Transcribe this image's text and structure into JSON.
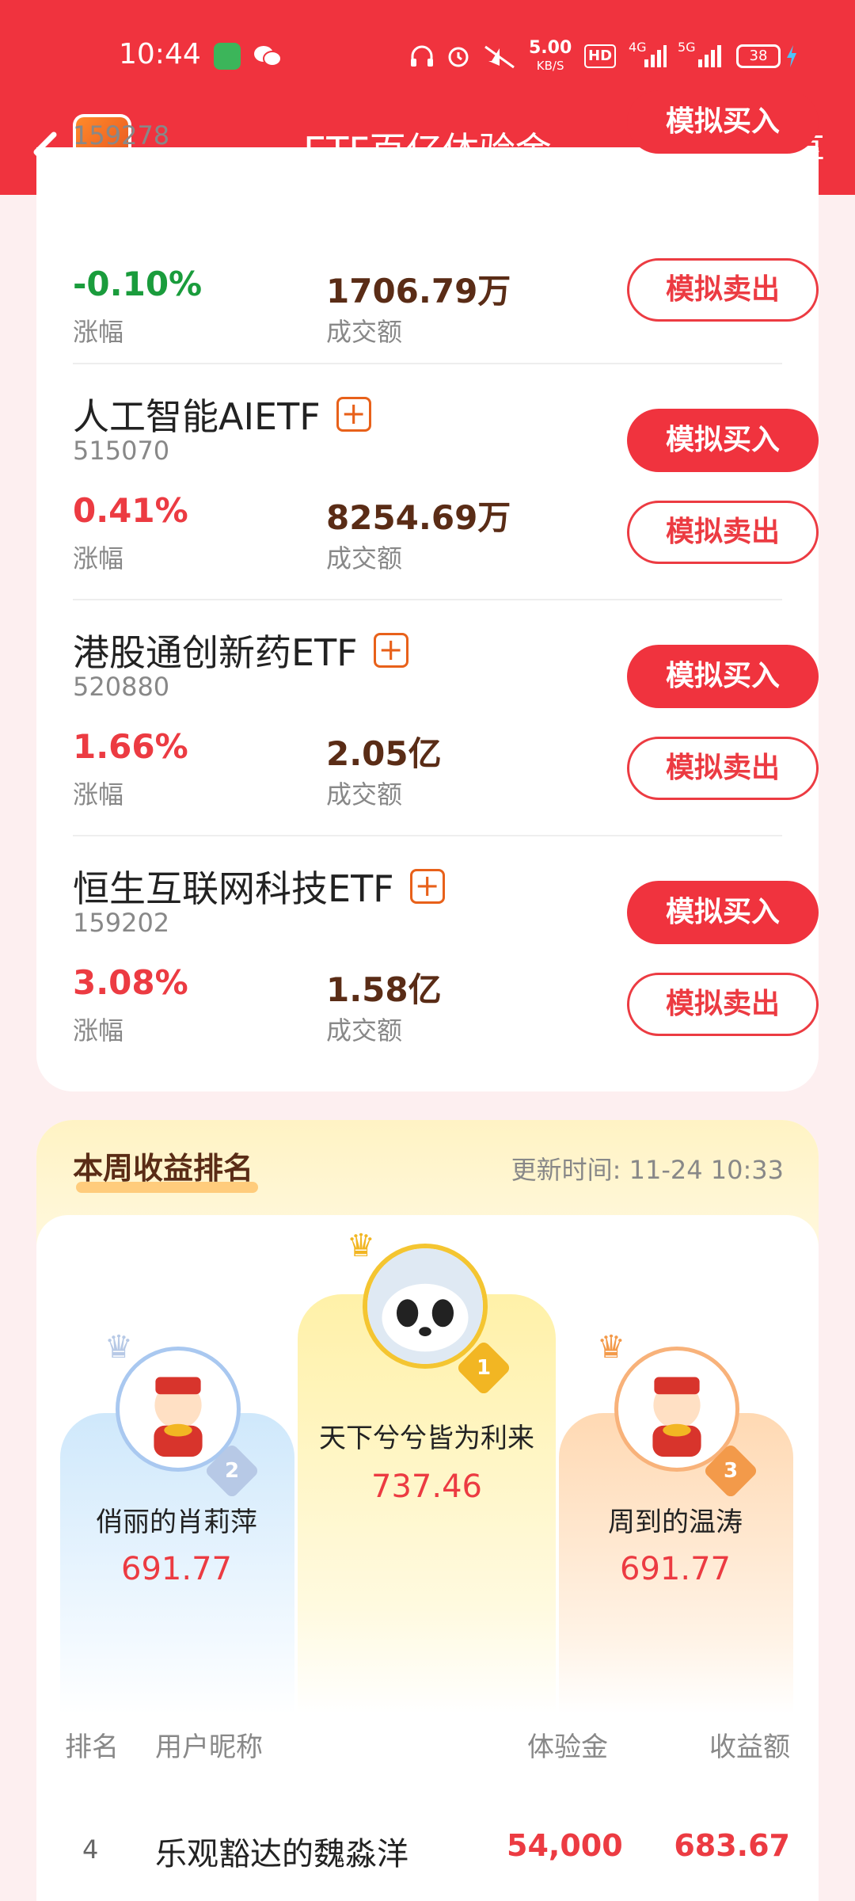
{
  "status_bar": {
    "time": "10:44",
    "speed_value": "5.00",
    "speed_unit": "KB/S",
    "hd": "HD",
    "network_1": "4G",
    "network_2": "5G",
    "battery": "38"
  },
  "header": {
    "title": "ETF百亿体验金",
    "share_label": "分享"
  },
  "etf_list": {
    "buy_label": "模拟买入",
    "sell_label": "模拟卖出",
    "pct_label": "涨幅",
    "vol_label": "成交额",
    "items": [
      {
        "code": "159278",
        "change": "-0.10%",
        "volume": "1706.79万"
      },
      {
        "name": "人工智能AIETF",
        "code": "515070",
        "change": "0.41%",
        "volume": "8254.69万"
      },
      {
        "name": "港股通创新药ETF",
        "code": "520880",
        "change": "1.66%",
        "volume": "2.05亿"
      },
      {
        "name": "恒生互联网科技ETF",
        "code": "159202",
        "change": "3.08%",
        "volume": "1.58亿"
      }
    ]
  },
  "ranking": {
    "title": "本周收益排名",
    "update_time": "更新时间: 11-24 10:33",
    "podium": [
      {
        "rank": "1",
        "name": "天下兮兮皆为利来",
        "value": "737.46"
      },
      {
        "rank": "2",
        "name": "俏丽的肖莉萍",
        "value": "691.77"
      },
      {
        "rank": "3",
        "name": "周到的温涛",
        "value": "691.77"
      }
    ],
    "columns": {
      "rank": "排名",
      "nickname": "用户昵称",
      "amount": "体验金",
      "profit": "收益额"
    },
    "rows": [
      {
        "rank": "4",
        "name": "乐观豁达的魏淼洋",
        "amount": "54,000",
        "profit": "683.67"
      }
    ]
  },
  "colors": {
    "brand_red": "#f0333e",
    "up_red": "#ec3b42",
    "down_green": "#1a9c3c",
    "gold": "#f4c531"
  }
}
